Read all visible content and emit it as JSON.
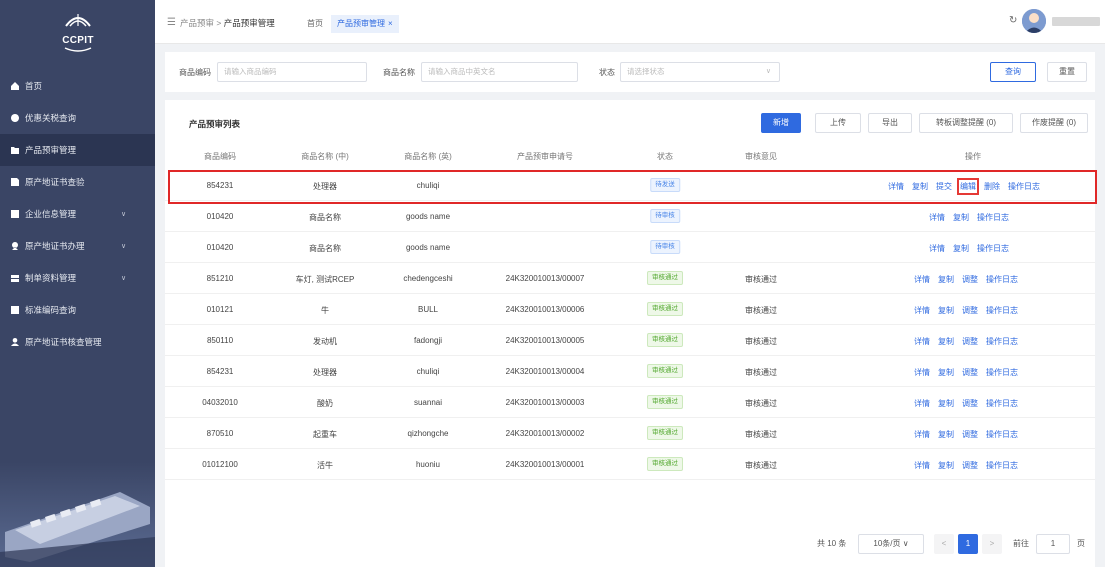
{
  "brand": {
    "logo_text": "CCPIT"
  },
  "sidebar": {
    "items": [
      {
        "label": "首页",
        "icon": "home-icon"
      },
      {
        "label": "优惠关税查询",
        "icon": "discount-icon"
      },
      {
        "label": "产品预审管理",
        "icon": "folder-icon",
        "active": true
      },
      {
        "label": "原产地证书查验",
        "icon": "verify-icon"
      },
      {
        "label": "企业信息管理",
        "icon": "company-icon",
        "chevron": "∨"
      },
      {
        "label": "原产地证书办理",
        "icon": "certificate-icon",
        "chevron": "∨"
      },
      {
        "label": "制单资料管理",
        "icon": "documents-icon",
        "chevron": "∨"
      },
      {
        "label": "标准编码查询",
        "icon": "code-icon"
      },
      {
        "label": "原产地证书核查管理",
        "icon": "user-check-icon"
      }
    ]
  },
  "topbar": {
    "breadcrumb_parent": "产品预审",
    "breadcrumb_sep": ">",
    "breadcrumb_current": "产品预审管理",
    "tabs": [
      {
        "label": "首页"
      },
      {
        "label": "产品预审管理",
        "close": "×"
      }
    ],
    "refresh_glyph": "↻"
  },
  "filter": {
    "code_label": "商品编码",
    "code_placeholder": "请输入商品编码",
    "name_label": "商品名称",
    "name_placeholder": "请输入商品中英文名",
    "status_label": "状态",
    "status_placeholder": "请选择状态",
    "search": "查询",
    "reset": "重置"
  },
  "table": {
    "title": "产品预审列表",
    "actions": {
      "add": "新增",
      "upload": "上传",
      "export": "导出",
      "transfer": "转板调整提醒 (0)",
      "void": "作废提醒 (0)"
    },
    "columns": [
      "商品编码",
      "商品名称 (中)",
      "商品名称 (英)",
      "产品预审申请号",
      "状态",
      "审核意见",
      "操作"
    ],
    "rows": [
      {
        "code": "854231",
        "name_cn": "处理器",
        "name_en": "chuliqi",
        "apply_no": "",
        "status": "待发送",
        "status_type": "pending",
        "opinion": "",
        "ops": [
          "详情",
          "复制",
          "提交",
          "编辑",
          "删除",
          "操作日志"
        ]
      },
      {
        "code": "010420",
        "name_cn": "商品名称",
        "name_en": "goods name",
        "apply_no": "",
        "status": "待审核",
        "status_type": "pending",
        "opinion": "",
        "ops": [
          "详情",
          "复制",
          "操作日志"
        ]
      },
      {
        "code": "010420",
        "name_cn": "商品名称",
        "name_en": "goods name",
        "apply_no": "",
        "status": "待审核",
        "status_type": "pending",
        "opinion": "",
        "ops": [
          "详情",
          "复制",
          "操作日志"
        ]
      },
      {
        "code": "851210",
        "name_cn": "车灯, 测试RCEP",
        "name_en": "chedengceshi",
        "apply_no": "24K320010013/00007",
        "status": "审核通过",
        "status_type": "pass",
        "opinion": "审核通过",
        "ops": [
          "详情",
          "复制",
          "调整",
          "操作日志"
        ]
      },
      {
        "code": "010121",
        "name_cn": "牛",
        "name_en": "BULL",
        "apply_no": "24K320010013/00006",
        "status": "审核通过",
        "status_type": "pass",
        "opinion": "审核通过",
        "ops": [
          "详情",
          "复制",
          "调整",
          "操作日志"
        ]
      },
      {
        "code": "850110",
        "name_cn": "发动机",
        "name_en": "fadongji",
        "apply_no": "24K320010013/00005",
        "status": "审核通过",
        "status_type": "pass",
        "opinion": "审核通过",
        "ops": [
          "详情",
          "复制",
          "调整",
          "操作日志"
        ]
      },
      {
        "code": "854231",
        "name_cn": "处理器",
        "name_en": "chuliqi",
        "apply_no": "24K320010013/00004",
        "status": "审核通过",
        "status_type": "pass",
        "opinion": "审核通过",
        "ops": [
          "详情",
          "复制",
          "调整",
          "操作日志"
        ]
      },
      {
        "code": "04032010",
        "name_cn": "酸奶",
        "name_en": "suannai",
        "apply_no": "24K320010013/00003",
        "status": "审核通过",
        "status_type": "pass",
        "opinion": "审核通过",
        "ops": [
          "详情",
          "复制",
          "调整",
          "操作日志"
        ]
      },
      {
        "code": "870510",
        "name_cn": "起重车",
        "name_en": "qizhongche",
        "apply_no": "24K320010013/00002",
        "status": "审核通过",
        "status_type": "pass",
        "opinion": "审核通过",
        "ops": [
          "详情",
          "复制",
          "调整",
          "操作日志"
        ]
      },
      {
        "code": "01012100",
        "name_cn": "活牛",
        "name_en": "huoniu",
        "apply_no": "24K320010013/00001",
        "status": "审核通过",
        "status_type": "pass",
        "opinion": "审核通过",
        "ops": [
          "详情",
          "复制",
          "调整",
          "操作日志"
        ]
      }
    ]
  },
  "pagination": {
    "total": "共 10 条",
    "page_size": "10条/页",
    "prev": "<",
    "current": "1",
    "next": ">",
    "goto_label": "前往",
    "goto_value": "1",
    "page_unit": "页"
  },
  "colors": {
    "primary": "#2f6ae0",
    "sidebar": "#3a4565",
    "highlight": "#e02828",
    "pass": "#52a82e",
    "pending": "#4a86e8"
  }
}
